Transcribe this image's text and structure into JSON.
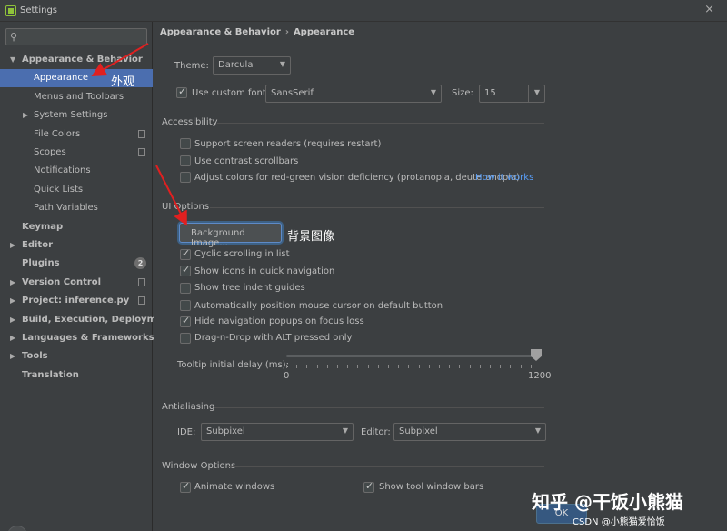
{
  "window": {
    "title": "Settings"
  },
  "sidebar": {
    "search_placeholder": "",
    "items": [
      {
        "label": "Appearance & Behavior",
        "bold": true,
        "arrow": "▼"
      },
      {
        "label": "Appearance",
        "selected": true
      },
      {
        "label": "Menus and Toolbars"
      },
      {
        "label": "System Settings",
        "arrow": "▶"
      },
      {
        "label": "File Colors",
        "copy_icon": true
      },
      {
        "label": "Scopes",
        "copy_icon": true
      },
      {
        "label": "Notifications"
      },
      {
        "label": "Quick Lists"
      },
      {
        "label": "Path Variables"
      },
      {
        "label": "Keymap",
        "bold": true
      },
      {
        "label": "Editor",
        "bold": true,
        "arrow": "▶"
      },
      {
        "label": "Plugins",
        "bold": true,
        "badge": "2"
      },
      {
        "label": "Version Control",
        "bold": true,
        "arrow": "▶",
        "copy_icon": true
      },
      {
        "label": "Project: inference.py",
        "bold": true,
        "arrow": "▶",
        "copy_icon": true
      },
      {
        "label": "Build, Execution, Deployment",
        "bold": true,
        "arrow": "▶"
      },
      {
        "label": "Languages & Frameworks",
        "bold": true,
        "arrow": "▶"
      },
      {
        "label": "Tools",
        "bold": true,
        "arrow": "▶"
      },
      {
        "label": "Translation",
        "bold": true
      }
    ]
  },
  "breadcrumb": {
    "first": "Appearance & Behavior",
    "separator": "›",
    "second": "Appearance"
  },
  "theme": {
    "label": "Theme:",
    "value": "Darcula"
  },
  "font": {
    "checkbox_label": "Use custom font:",
    "value": "SansSerif",
    "size_label": "Size:",
    "size_value": "15"
  },
  "accessibility": {
    "title": "Accessibility",
    "items": [
      {
        "label": "Support screen readers (requires restart)",
        "checked": false
      },
      {
        "label": "Use contrast scrollbars",
        "checked": false
      },
      {
        "label": "Adjust colors for red-green vision deficiency (protanopia, deuteranopia)",
        "checked": false
      }
    ],
    "link": "How it works"
  },
  "ui_options": {
    "title": "UI Options",
    "button": "Background Image...",
    "items": [
      {
        "label": "Cyclic scrolling in list",
        "checked": true
      },
      {
        "label": "Show icons in quick navigation",
        "checked": true
      },
      {
        "label": "Show tree indent guides",
        "checked": false
      },
      {
        "label": "Automatically position mouse cursor on default button",
        "checked": false
      },
      {
        "label": "Hide navigation popups on focus loss",
        "checked": true
      },
      {
        "label": "Drag-n-Drop with ALT pressed only",
        "checked": false
      }
    ],
    "tooltip_label": "Tooltip initial delay (ms):",
    "slider_min": "0",
    "slider_max": "1200",
    "slider_value": 1200
  },
  "antialiasing": {
    "title": "Antialiasing",
    "ide_label": "IDE:",
    "ide_value": "Subpixel",
    "editor_label": "Editor:",
    "editor_value": "Subpixel"
  },
  "window_options": {
    "title": "Window Options",
    "animate_label": "Animate windows",
    "toolbars_label": "Show tool window bars"
  },
  "footer": {
    "help": "?",
    "ok": "OK"
  },
  "annotations": {
    "appearance_note": "外观",
    "bg_note": "背景图像"
  },
  "watermark": {
    "main": "知乎 @干饭小熊猫",
    "sub": "CSDN @小熊猫爱恰饭"
  },
  "colors": {
    "accent": "#4b6eaf",
    "link": "#589df6",
    "annotation_arrow": "#e02020"
  }
}
